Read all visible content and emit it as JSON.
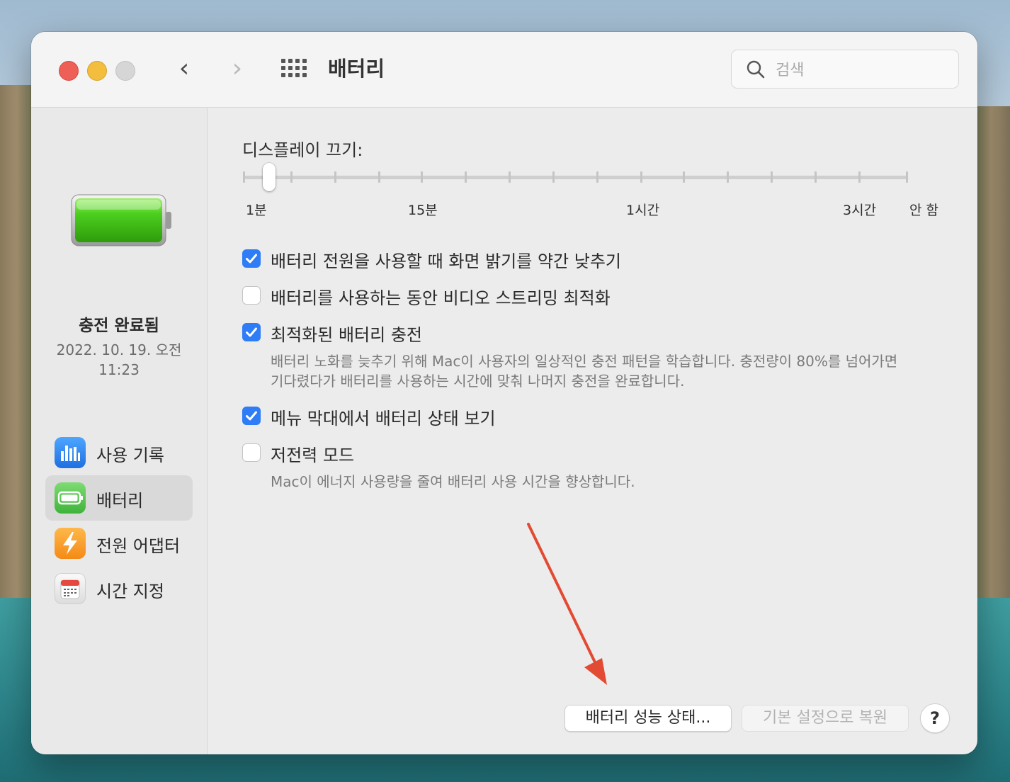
{
  "window": {
    "title": "배터리"
  },
  "search": {
    "placeholder": "검색",
    "value": ""
  },
  "sidebar": {
    "status_title": "충전 완료됨",
    "status_time_line1": "2022. 10. 19. 오전",
    "status_time_line2": "11:23",
    "items": [
      {
        "label": "사용 기록",
        "icon": "usage-history-icon",
        "selected": false
      },
      {
        "label": "배터리",
        "icon": "battery-icon",
        "selected": true
      },
      {
        "label": "전원 어댑터",
        "icon": "power-adapter-icon",
        "selected": false
      },
      {
        "label": "시간 지정",
        "icon": "schedule-icon",
        "selected": false
      }
    ]
  },
  "display_off": {
    "label": "디스플레이 끄기:",
    "tick_labels": [
      "1분",
      "15분",
      "1시간",
      "3시간",
      "안 함"
    ],
    "selected": "1분"
  },
  "options": [
    {
      "label": "배터리 전원을 사용할 때 화면 밝기를 약간 낮추기",
      "checked": true
    },
    {
      "label": "배터리를 사용하는 동안 비디오 스트리밍 최적화",
      "checked": false
    },
    {
      "label": "최적화된 배터리 충전",
      "checked": true,
      "description_line1": "배터리 노화를 늦추기 위해 Mac이 사용자의 일상적인 충전 패턴을 학습합니다. 충전량이 80%를 넘어가면",
      "description_line2": "기다렸다가 배터리를 사용하는 시간에 맞춰 나머지 충전을 완료합니다."
    },
    {
      "label": "메뉴 막대에서 배터리 상태 보기",
      "checked": true
    },
    {
      "label": "저전력 모드",
      "checked": false,
      "description_line1": "Mac이 에너지 사용량을 줄여 배터리 사용 시간을 향상합니다."
    }
  ],
  "buttons": {
    "battery_health": "배터리 성능 상태...",
    "restore_defaults": "기본 설정으로 복원",
    "help": "?"
  },
  "colors": {
    "accent": "#2e7cf6",
    "annotation_arrow": "#e34a33"
  }
}
